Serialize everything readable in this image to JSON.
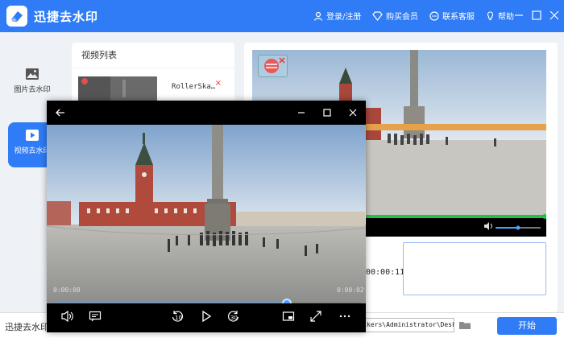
{
  "app": {
    "title": "迅捷去水印",
    "nav": {
      "login": "登录/注册",
      "vip": "购买会员",
      "support": "联系客服",
      "help": "帮助"
    }
  },
  "sidebar": {
    "items": [
      {
        "label": "图片去水印",
        "icon": "image-icon",
        "active": false
      },
      {
        "label": "视频去水印",
        "icon": "video-play-icon",
        "active": true
      }
    ]
  },
  "video_list": {
    "header": "视频列表",
    "items": [
      {
        "name": "RollerSka…",
        "delete": "×"
      }
    ]
  },
  "preview": {
    "timecode": "00:00:11",
    "progress": 0.995,
    "volume": 0.5
  },
  "bottom": {
    "label": "迅捷去水印",
    "output_path": "kers\\Administrator\\Desktop",
    "start_button": "开始"
  },
  "player": {
    "current_time": "0:00:08",
    "remaining_time": "0:00:02",
    "progress": 0.76,
    "skip_back": "10",
    "skip_forward": "30"
  },
  "colors": {
    "brand": "#2f7cf6",
    "progress_green": "#22c04a",
    "seek_blue": "#4aa3ff",
    "delete_red": "#e33333"
  }
}
